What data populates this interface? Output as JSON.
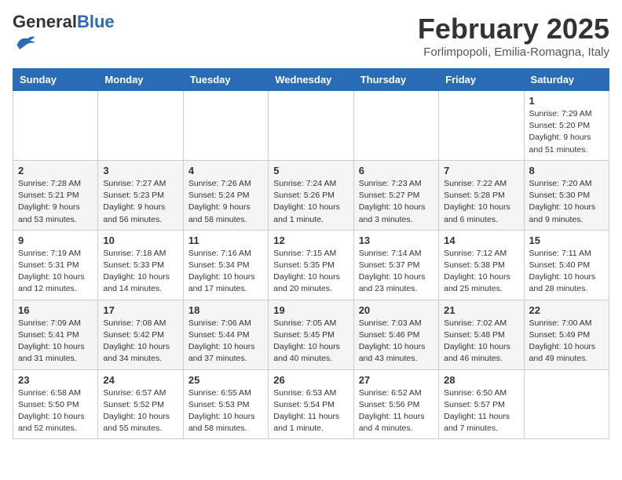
{
  "header": {
    "logo_general": "General",
    "logo_blue": "Blue",
    "month_year": "February 2025",
    "location": "Forlimpopoli, Emilia-Romagna, Italy"
  },
  "weekdays": [
    "Sunday",
    "Monday",
    "Tuesday",
    "Wednesday",
    "Thursday",
    "Friday",
    "Saturday"
  ],
  "weeks": [
    [
      {
        "day": "",
        "info": ""
      },
      {
        "day": "",
        "info": ""
      },
      {
        "day": "",
        "info": ""
      },
      {
        "day": "",
        "info": ""
      },
      {
        "day": "",
        "info": ""
      },
      {
        "day": "",
        "info": ""
      },
      {
        "day": "1",
        "info": "Sunrise: 7:29 AM\nSunset: 5:20 PM\nDaylight: 9 hours\nand 51 minutes."
      }
    ],
    [
      {
        "day": "2",
        "info": "Sunrise: 7:28 AM\nSunset: 5:21 PM\nDaylight: 9 hours\nand 53 minutes."
      },
      {
        "day": "3",
        "info": "Sunrise: 7:27 AM\nSunset: 5:23 PM\nDaylight: 9 hours\nand 56 minutes."
      },
      {
        "day": "4",
        "info": "Sunrise: 7:26 AM\nSunset: 5:24 PM\nDaylight: 9 hours\nand 58 minutes."
      },
      {
        "day": "5",
        "info": "Sunrise: 7:24 AM\nSunset: 5:26 PM\nDaylight: 10 hours\nand 1 minute."
      },
      {
        "day": "6",
        "info": "Sunrise: 7:23 AM\nSunset: 5:27 PM\nDaylight: 10 hours\nand 3 minutes."
      },
      {
        "day": "7",
        "info": "Sunrise: 7:22 AM\nSunset: 5:28 PM\nDaylight: 10 hours\nand 6 minutes."
      },
      {
        "day": "8",
        "info": "Sunrise: 7:20 AM\nSunset: 5:30 PM\nDaylight: 10 hours\nand 9 minutes."
      }
    ],
    [
      {
        "day": "9",
        "info": "Sunrise: 7:19 AM\nSunset: 5:31 PM\nDaylight: 10 hours\nand 12 minutes."
      },
      {
        "day": "10",
        "info": "Sunrise: 7:18 AM\nSunset: 5:33 PM\nDaylight: 10 hours\nand 14 minutes."
      },
      {
        "day": "11",
        "info": "Sunrise: 7:16 AM\nSunset: 5:34 PM\nDaylight: 10 hours\nand 17 minutes."
      },
      {
        "day": "12",
        "info": "Sunrise: 7:15 AM\nSunset: 5:35 PM\nDaylight: 10 hours\nand 20 minutes."
      },
      {
        "day": "13",
        "info": "Sunrise: 7:14 AM\nSunset: 5:37 PM\nDaylight: 10 hours\nand 23 minutes."
      },
      {
        "day": "14",
        "info": "Sunrise: 7:12 AM\nSunset: 5:38 PM\nDaylight: 10 hours\nand 25 minutes."
      },
      {
        "day": "15",
        "info": "Sunrise: 7:11 AM\nSunset: 5:40 PM\nDaylight: 10 hours\nand 28 minutes."
      }
    ],
    [
      {
        "day": "16",
        "info": "Sunrise: 7:09 AM\nSunset: 5:41 PM\nDaylight: 10 hours\nand 31 minutes."
      },
      {
        "day": "17",
        "info": "Sunrise: 7:08 AM\nSunset: 5:42 PM\nDaylight: 10 hours\nand 34 minutes."
      },
      {
        "day": "18",
        "info": "Sunrise: 7:06 AM\nSunset: 5:44 PM\nDaylight: 10 hours\nand 37 minutes."
      },
      {
        "day": "19",
        "info": "Sunrise: 7:05 AM\nSunset: 5:45 PM\nDaylight: 10 hours\nand 40 minutes."
      },
      {
        "day": "20",
        "info": "Sunrise: 7:03 AM\nSunset: 5:46 PM\nDaylight: 10 hours\nand 43 minutes."
      },
      {
        "day": "21",
        "info": "Sunrise: 7:02 AM\nSunset: 5:48 PM\nDaylight: 10 hours\nand 46 minutes."
      },
      {
        "day": "22",
        "info": "Sunrise: 7:00 AM\nSunset: 5:49 PM\nDaylight: 10 hours\nand 49 minutes."
      }
    ],
    [
      {
        "day": "23",
        "info": "Sunrise: 6:58 AM\nSunset: 5:50 PM\nDaylight: 10 hours\nand 52 minutes."
      },
      {
        "day": "24",
        "info": "Sunrise: 6:57 AM\nSunset: 5:52 PM\nDaylight: 10 hours\nand 55 minutes."
      },
      {
        "day": "25",
        "info": "Sunrise: 6:55 AM\nSunset: 5:53 PM\nDaylight: 10 hours\nand 58 minutes."
      },
      {
        "day": "26",
        "info": "Sunrise: 6:53 AM\nSunset: 5:54 PM\nDaylight: 11 hours\nand 1 minute."
      },
      {
        "day": "27",
        "info": "Sunrise: 6:52 AM\nSunset: 5:56 PM\nDaylight: 11 hours\nand 4 minutes."
      },
      {
        "day": "28",
        "info": "Sunrise: 6:50 AM\nSunset: 5:57 PM\nDaylight: 11 hours\nand 7 minutes."
      },
      {
        "day": "",
        "info": ""
      }
    ]
  ]
}
